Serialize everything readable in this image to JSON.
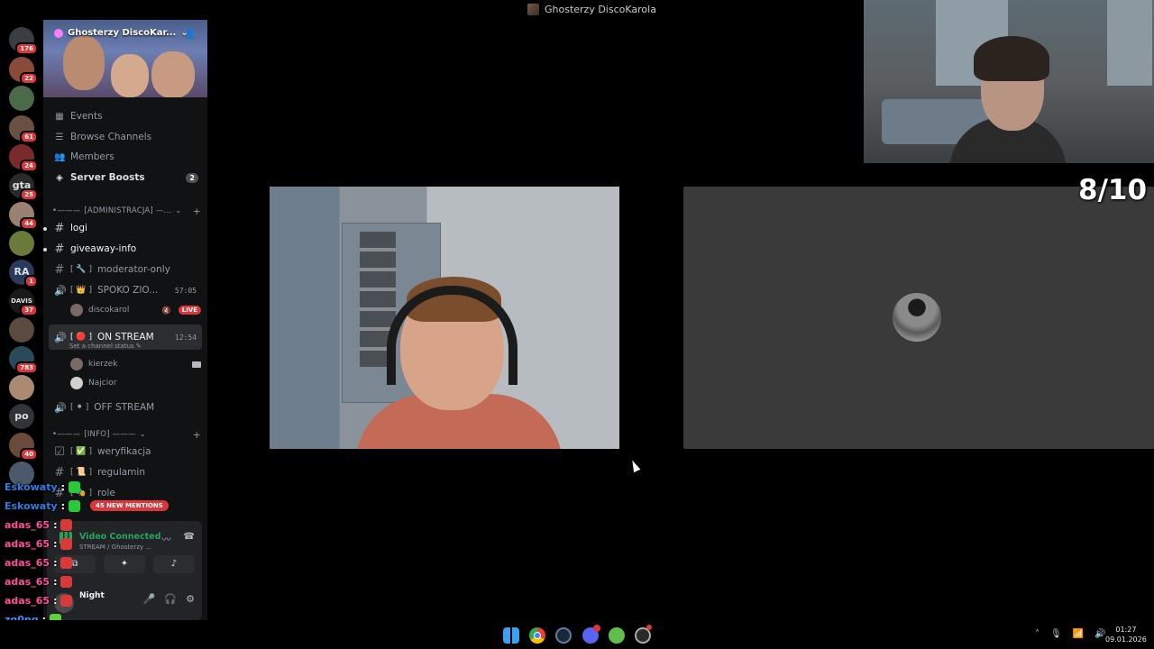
{
  "window": {
    "title": "Ghosterzy DiscoKarola"
  },
  "rail": {
    "servers": [
      {
        "name": "discord",
        "badge": "176",
        "color": "#3a3d44"
      },
      {
        "name": "server-2",
        "badge": "22",
        "color": "#8a4a3a"
      },
      {
        "name": "server-3",
        "badge": "",
        "color": "#4a6a4a"
      },
      {
        "name": "server-4",
        "badge": "61",
        "color": "#6a5040"
      },
      {
        "name": "server-5",
        "badge": "24",
        "color": "#7a2a2a"
      },
      {
        "name": "server-gta",
        "badge": "25",
        "color": "#2a2a2a",
        "text": "gta"
      },
      {
        "name": "server-7",
        "badge": "44",
        "color": "#9a8070"
      },
      {
        "name": "server-8",
        "badge": "",
        "color": "#6a7a3a"
      },
      {
        "name": "server-ra",
        "badge": "1",
        "color": "#2a3a5a",
        "text": "RA"
      },
      {
        "name": "server-davis",
        "badge": "37",
        "color": "#1a1a1a",
        "text": "DAVIS"
      },
      {
        "name": "server-11",
        "badge": "",
        "color": "#5a4a40"
      },
      {
        "name": "server-12",
        "badge": "783",
        "color": "#2a4a5a"
      },
      {
        "name": "server-13",
        "badge": "",
        "color": "#aa8a70"
      },
      {
        "name": "server-po",
        "badge": "",
        "color": "#313338",
        "text": "po"
      },
      {
        "name": "server-15",
        "badge": "40",
        "color": "#6a4a3a"
      },
      {
        "name": "server-16",
        "badge": "",
        "color": "#4a5a6a"
      }
    ]
  },
  "server": {
    "name": "Ghosterzy DiscoKar..."
  },
  "nav": {
    "events": "Events",
    "browse": "Browse Channels",
    "members": "Members",
    "boosts": "Server Boosts",
    "boosts_count": "2"
  },
  "categories": {
    "admin": "[ADMINISTRACJA] —...",
    "info": "[INFO] ———"
  },
  "channels": {
    "logi": "logi",
    "giveaway": "giveaway-info",
    "moderator": "moderator-only",
    "moderator_prefix": "[ 🔧 ]",
    "spoko": "SPOKO ZIO...",
    "spoko_prefix": "[ 👑 ]",
    "spoko_timer": "57:05",
    "onstream": "ON STREAM",
    "onstream_prefix": "[ 🔴 ]",
    "onstream_timer": "12:54",
    "onstream_status": "Set a channel status ✎",
    "offstream": "OFF STREAM",
    "offstream_prefix": "[ ⚫ ]",
    "weryfikacja": "weryfikacja",
    "weryfikacja_prefix": "[ ✅ ]",
    "regulamin": "regulamin",
    "regulamin_prefix": "[ 📜 ]",
    "role": "role",
    "role_prefix": "[ 🎭 ]"
  },
  "voice_users": {
    "discokarol": "discokarol",
    "live": "LIVE",
    "kierzek": "kierzek",
    "najcior": "Najcior"
  },
  "mentions": "45 NEW MENTIONS",
  "voice_panel": {
    "status": "Video Connected",
    "sub": "STREAM / Ghosterzy ...",
    "user": "Night"
  },
  "chat": [
    {
      "user": "Eskowaty",
      "sep": ":",
      "color": "#2f7de1",
      "emote": "#29c93a"
    },
    {
      "user": "Eskowaty",
      "sep": ":",
      "color": "#2f7de1",
      "emote": "#29c93a"
    },
    {
      "user": "adas_65",
      "sep": ":",
      "color": "#ff4f9a",
      "emote": "#d83a3a"
    },
    {
      "user": "adas_65",
      "sep": ":",
      "color": "#ff4f9a",
      "emote": "#d83a3a"
    },
    {
      "user": "adas_65",
      "sep": ":",
      "color": "#ff4f9a",
      "emote": "#d83a3a"
    },
    {
      "user": "adas_65",
      "sep": ":",
      "color": "#ff4f9a",
      "emote": "#d83a3a"
    },
    {
      "user": "adas_65",
      "sep": ":",
      "color": "#ff4f9a",
      "emote": "#d83a3a"
    },
    {
      "user": "zg0nq",
      "sep": ":",
      "color": "#3d8bff",
      "emote": "#5fd13a"
    }
  ],
  "overlay": {
    "score": "8/10"
  },
  "taskbar": {
    "time": "01:27",
    "date": "09.01.2026"
  }
}
